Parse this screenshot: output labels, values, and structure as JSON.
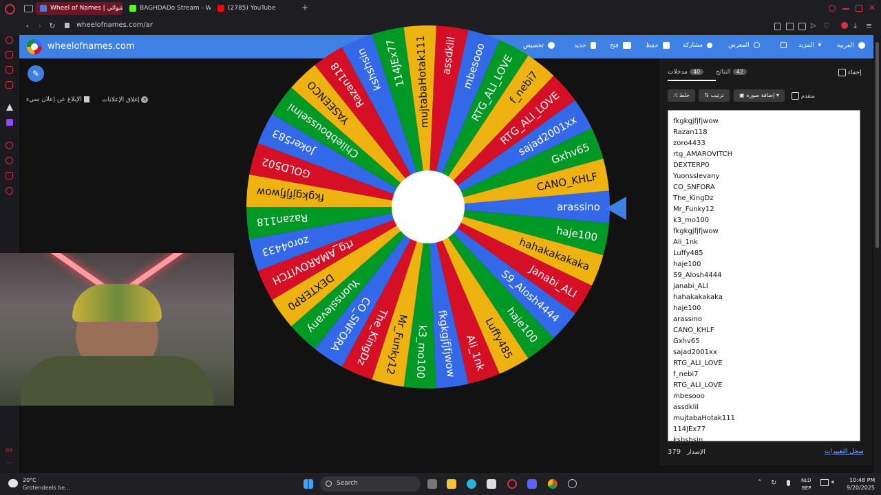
{
  "browser": {
    "tabs": [
      {
        "label": "Wheel of Names | عشوائي",
        "color": "#3f80e4"
      },
      {
        "label": "BAGHDADo Stream - Wat",
        "color": "#53fc18"
      },
      {
        "label": "(2785) YouTube",
        "color": "#ff0000"
      }
    ],
    "new_tab": "+",
    "url": "wheelofnames.com/ar"
  },
  "header": {
    "title": "wheelofnames.com",
    "menu": [
      {
        "label": "العربية",
        "icon": "globe-icon"
      },
      {
        "label": "المزيد",
        "icon": "chevron-down-icon"
      },
      {
        "label": "",
        "icon": "fullscreen-icon"
      },
      {
        "label": "المعرض",
        "icon": "search-icon"
      },
      {
        "label": "مشاركة",
        "icon": "share-icon"
      },
      {
        "label": "حفظ",
        "icon": "save-icon"
      },
      {
        "label": "فتح",
        "icon": "folder-icon"
      },
      {
        "label": "جديد",
        "icon": "file-icon"
      },
      {
        "label": "تخصيص",
        "icon": "palette-icon"
      }
    ]
  },
  "ads": {
    "close_ads": "إغلاق الإعلانات",
    "report_ad": "الإبلاغ عن إعلان سيء"
  },
  "wheel": {
    "slices": [
      "arassino",
      "haje100",
      "hahakakakaka",
      "Janabi_ALI",
      "S9_Alosh4444",
      "haje100",
      "Luffy485",
      "Ali_1nk",
      "fkgkgjfjfjwow",
      "k3_mo100",
      "Mr_Funky12",
      "The_KingDz",
      "CO_SNFORA",
      "Yuonsslevany",
      "DEXTERP0",
      "rtg_AMAROVITCH",
      "zoro4433",
      "Razan118",
      "fkgkgjfjfjwow",
      "GOLD502",
      "Joker583",
      "Chilebbousselmi",
      "YASEENCO",
      "Razan118",
      "kshshsin",
      "114JEx77",
      "mujtabaHotak111",
      "assdklil",
      "mbesooo",
      "RTG_ALI_LOVE",
      "f_nebi7",
      "RTG_ALI_LOVE",
      "sajad2001xx",
      "Gxhv65",
      "CANO_KHLF"
    ],
    "colors": [
      "#3369e8",
      "#009925",
      "#eeb211",
      "#d50f25"
    ]
  },
  "panel": {
    "tabs": {
      "entries_label": "مدخلات",
      "entries_count": "40",
      "results_label": "النتائج",
      "results_count": "42",
      "hide_label": "إخفاء"
    },
    "toolbar": {
      "shuffle": "خلط",
      "sort": "ترتيب",
      "add_image": "إضافة صورة",
      "advanced": "متقدم"
    },
    "entries": [
      "fkgkgjfjfjwow",
      "Razan118",
      "zoro4433",
      "rtg_AMAROVITCH",
      "DEXTERP0",
      "Yuonsslevany",
      "CO_SNFORA",
      "The_KingDz",
      "Mr_Funky12",
      "k3_mo100",
      "fkgkgjfjfjwow",
      "Ali_1nk",
      "Luffy485",
      "haje100",
      "S9_Alosh4444",
      "janabi_ALI",
      "hahakakakaka",
      "haje100",
      "arassino",
      "CANO_KHLF",
      "Gxhv65",
      "sajad2001xx",
      "RTG_ALI_LOVE",
      "f_nebi7",
      "RTG_ALI_LOVE",
      "mbesooo",
      "assdklil",
      "mujtabaHotak111",
      "114JEx77",
      "kshshsin"
    ],
    "footer": {
      "changelog": "سجل التغييرات",
      "version_label": "الإصدار",
      "version": "379"
    }
  },
  "taskbar": {
    "weather_temp": "20°C",
    "weather_desc": "Grotendeels be...",
    "search": "Search",
    "lang_top": "NLD",
    "lang_bottom": "BEP",
    "time": "10:48 PM",
    "date": "9/20/2025"
  }
}
